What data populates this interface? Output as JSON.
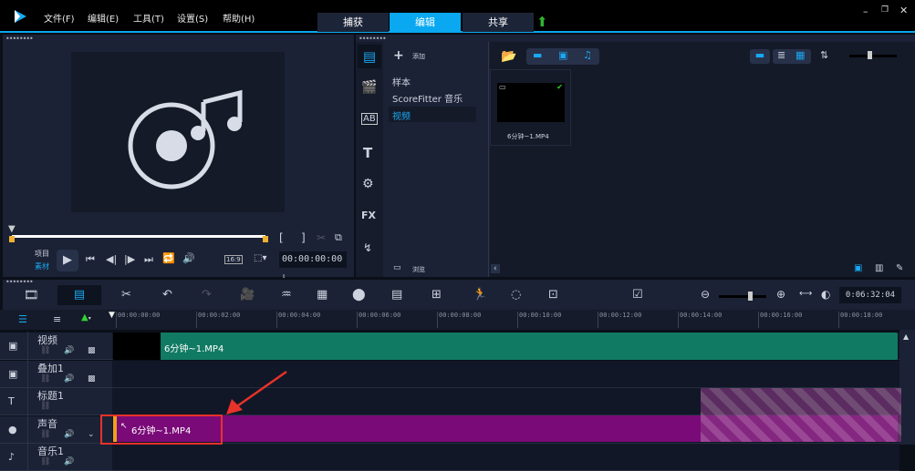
{
  "menu": [
    "文件(F)",
    "编辑(E)",
    "工具(T)",
    "设置(S)",
    "帮助(H)"
  ],
  "tabs": [
    "捕获",
    "编辑",
    "共享"
  ],
  "active_tab": "编辑",
  "window_controls": [
    "minimize",
    "restore",
    "close"
  ],
  "player": {
    "project_label": "项目",
    "clip_label": "素材",
    "aspect": "16:9",
    "timecode": "00:00:00:00"
  },
  "library": {
    "add_label": "添加",
    "nav": [
      "样本",
      "ScoreFitter 音乐",
      "视频"
    ],
    "selected_nav": "视频",
    "browse_label": "浏览",
    "thumb_name": "6分钟~1.MP4"
  },
  "timeline": {
    "duration": "0:06:32:04",
    "ruler": [
      "00:00:00:00",
      "00:00:02:00",
      "00:00:04:00",
      "00:00:06:00",
      "00:00:08:00",
      "00:00:10:00",
      "00:00:12:00",
      "00:00:14:00",
      "00:00:16:00",
      "00:00:18:00"
    ],
    "tracks": [
      "视频",
      "叠加1",
      "标题1",
      "声音",
      "音乐1"
    ],
    "video_clip": "6分钟~1.MP4",
    "audio_clip": "6分钟~1.MP4"
  },
  "colors": {
    "accent": "#0aa8f0",
    "video_clip": "#117a62",
    "audio_clip": "#7a0a78",
    "annotation": "#e8322a"
  }
}
